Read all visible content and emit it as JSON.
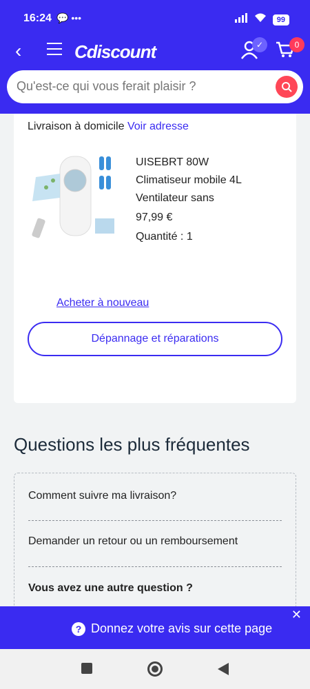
{
  "status": {
    "time": "16:24",
    "battery": "99"
  },
  "header": {
    "logo": "Cdiscount",
    "cart_count": "0"
  },
  "search": {
    "placeholder": "Qu'est-ce qui vous ferait plaisir ?"
  },
  "order": {
    "delivery_label": "Livraison à domicile",
    "delivery_link": "Voir adresse",
    "product_title": "UISEBRT 80W Climatiseur mobile 4L Ventilateur sans",
    "price": "97,99 €",
    "quantity": "Quantité : 1",
    "buy_again": "Acheter à nouveau",
    "repair_button": "Dépannage et réparations"
  },
  "faq": {
    "title": "Questions les plus fréquentes",
    "items": [
      "Comment suivre ma livraison?",
      "Demander un retour ou un remboursement"
    ],
    "other_question": "Vous avez une autre question ?"
  },
  "feedback": {
    "text": "Donnez votre avis sur cette page"
  },
  "colors": {
    "brand": "#3a2bf1",
    "accent": "#ff4757"
  }
}
